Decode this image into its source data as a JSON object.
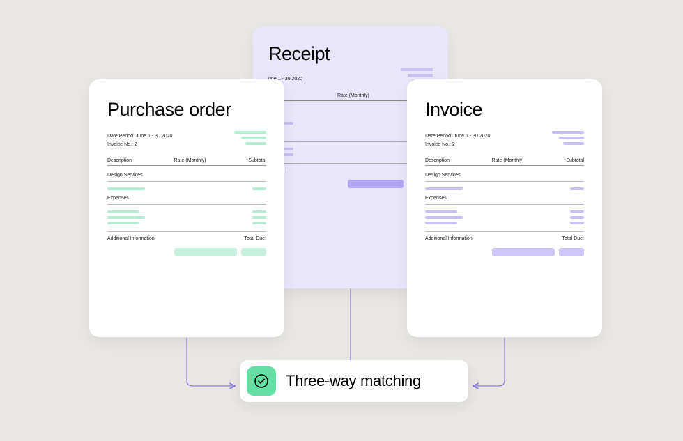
{
  "receipt": {
    "title": "Receipt",
    "date_period_label": "une 1 - 30 2020",
    "hdr_rate": "Rate (Monthly)",
    "section_information": "rmation:"
  },
  "po": {
    "title": "Purchase order",
    "date_period": "Date Period: June 1 - 30 2020",
    "invoice_no": "Invoice No.: 2",
    "hdr_description": "Description",
    "hdr_rate": "Rate (Monthly)",
    "hdr_subtotal": "Subtotal",
    "section_design": "Design Services",
    "section_expenses": "Expenses",
    "addl_info": "Additional Information:",
    "total_due": "Total Due:"
  },
  "invoice": {
    "title": "Invoice",
    "date_period": "Date Period: June 1 - 30 2020",
    "invoice_no": "Invoice No.: 2",
    "hdr_description": "Description",
    "hdr_rate": "Rate (Monthly)",
    "hdr_subtotal": "Subtotal",
    "section_design": "Design Services",
    "section_expenses": "Expenses",
    "addl_info": "Additional Information:",
    "total_due": "Total Due:"
  },
  "result": {
    "label": "Three-way matching"
  },
  "colors": {
    "mint": "#b6ecd4",
    "lavender": "#c7c0f2",
    "arrow": "#8d7ae8"
  }
}
